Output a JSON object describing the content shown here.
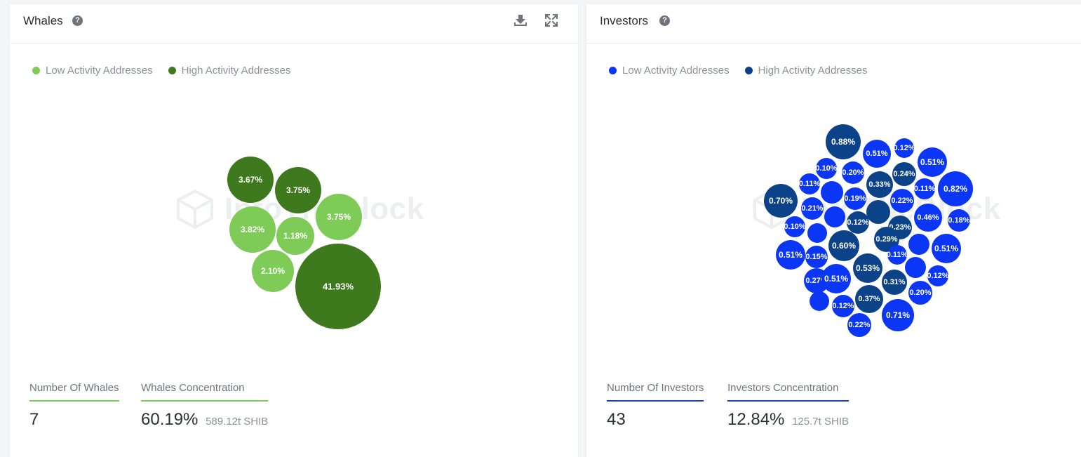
{
  "whales": {
    "title": "Whales",
    "help_icon": "question-circle-icon",
    "download_icon": "download-icon",
    "expand_icon": "expand-icon",
    "legend": [
      {
        "label": "Low Activity Addresses",
        "color": "#7fcb57"
      },
      {
        "label": "High Activity Addresses",
        "color": "#3e7a1d"
      }
    ],
    "watermark": "IntoTheBlock",
    "stats": {
      "count_label": "Number Of Whales",
      "count_value": "7",
      "concentration_label": "Whales Concentration",
      "concentration_value": "60.19%",
      "concentration_sub": "589.12t SHIB",
      "accent": "#7fcb57"
    }
  },
  "investors": {
    "title": "Investors",
    "help_icon": "question-circle-icon",
    "legend": [
      {
        "label": "Low Activity Addresses",
        "color": "#0b36f5"
      },
      {
        "label": "High Activity Addresses",
        "color": "#0c4287"
      }
    ],
    "watermark": "IntoTheBlock",
    "stats": {
      "count_label": "Number Of Investors",
      "count_value": "43",
      "concentration_label": "Investors Concentration",
      "concentration_value": "12.84%",
      "concentration_sub": "125.7t SHIB",
      "accent": "#1f3fb0"
    }
  },
  "chart_data": [
    {
      "type": "bubble",
      "title": "Whales",
      "unit": "% of supply",
      "series": [
        {
          "name": "Low Activity Addresses",
          "color": "#7fcb57"
        },
        {
          "name": "High Activity Addresses",
          "color": "#3e7a1d"
        }
      ],
      "points": [
        {
          "value": 3.67,
          "label": "3.67%",
          "series": "High Activity Addresses"
        },
        {
          "value": 3.75,
          "label": "3.75%",
          "series": "High Activity Addresses"
        },
        {
          "value": 3.82,
          "label": "3.82%",
          "series": "Low Activity Addresses"
        },
        {
          "value": 1.18,
          "label": "1.18%",
          "series": "Low Activity Addresses"
        },
        {
          "value": 3.75,
          "label": "3.75%",
          "series": "Low Activity Addresses"
        },
        {
          "value": 2.1,
          "label": "2.10%",
          "series": "Low Activity Addresses"
        },
        {
          "value": 41.93,
          "label": "41.93%",
          "series": "High Activity Addresses"
        }
      ]
    },
    {
      "type": "bubble",
      "title": "Investors",
      "unit": "% of supply",
      "series": [
        {
          "name": "Low Activity Addresses",
          "color": "#0b36f5"
        },
        {
          "name": "High Activity Addresses",
          "color": "#0c4287"
        }
      ],
      "points": [
        {
          "value": 0.88,
          "label": "0.88%",
          "series": "High Activity Addresses"
        },
        {
          "value": 0.51,
          "label": "0.51%",
          "series": "Low Activity Addresses"
        },
        {
          "value": 0.12,
          "label": "0.12%",
          "series": "Low Activity Addresses"
        },
        {
          "value": 0.51,
          "label": "0.51%",
          "series": "Low Activity Addresses"
        },
        {
          "value": 0.1,
          "label": "0.10%",
          "series": "Low Activity Addresses"
        },
        {
          "value": 0.2,
          "label": "0.20%",
          "series": "Low Activity Addresses"
        },
        {
          "value": 0.24,
          "label": "0.24%",
          "series": "High Activity Addresses"
        },
        {
          "value": 0.11,
          "label": "0.11%",
          "series": "Low Activity Addresses"
        },
        {
          "value": 0.33,
          "label": "0.33%",
          "series": "High Activity Addresses"
        },
        {
          "value": 0.11,
          "label": "0.11%",
          "series": "Low Activity Addresses"
        },
        {
          "value": 0.82,
          "label": "0.82%",
          "series": "Low Activity Addresses"
        },
        {
          "value": 0.7,
          "label": "0.70%",
          "series": "High Activity Addresses"
        },
        {
          "value": 0.21,
          "label": "0.21%",
          "series": "Low Activity Addresses"
        },
        {
          "value": 0.19,
          "label": "0.19%",
          "series": "Low Activity Addresses"
        },
        {
          "value": 0.22,
          "label": "0.22%",
          "series": "Low Activity Addresses"
        },
        {
          "value": 0.46,
          "label": "0.46%",
          "series": "Low Activity Addresses"
        },
        {
          "value": 0.18,
          "label": "0.18%",
          "series": "Low Activity Addresses"
        },
        {
          "value": 0.1,
          "label": "0.10%",
          "series": "Low Activity Addresses"
        },
        {
          "value": 0.12,
          "label": "0.12%",
          "series": "High Activity Addresses"
        },
        {
          "value": 0.23,
          "label": "0.23%",
          "series": "High Activity Addresses"
        },
        {
          "value": 0.6,
          "label": "0.60%",
          "series": "High Activity Addresses"
        },
        {
          "value": 0.29,
          "label": "0.29%",
          "series": "High Activity Addresses"
        },
        {
          "value": 0.51,
          "label": "0.51%",
          "series": "Low Activity Addresses"
        },
        {
          "value": 0.15,
          "label": "0.15%",
          "series": "Low Activity Addresses"
        },
        {
          "value": 0.11,
          "label": "0.11%",
          "series": "Low Activity Addresses"
        },
        {
          "value": 0.51,
          "label": "0.51%",
          "series": "Low Activity Addresses"
        },
        {
          "value": 0.53,
          "label": "0.53%",
          "series": "High Activity Addresses"
        },
        {
          "value": 0.27,
          "label": "0.27%",
          "series": "Low Activity Addresses"
        },
        {
          "value": 0.51,
          "label": "0.51%",
          "series": "Low Activity Addresses"
        },
        {
          "value": 0.31,
          "label": "0.31%",
          "series": "High Activity Addresses"
        },
        {
          "value": 0.12,
          "label": "0.12%",
          "series": "Low Activity Addresses"
        },
        {
          "value": 0.2,
          "label": "0.20%",
          "series": "Low Activity Addresses"
        },
        {
          "value": 0.37,
          "label": "0.37%",
          "series": "High Activity Addresses"
        },
        {
          "value": 0.12,
          "label": "0.12%",
          "series": "Low Activity Addresses"
        },
        {
          "value": 0.71,
          "label": "0.71%",
          "series": "Low Activity Addresses"
        },
        {
          "value": 0.22,
          "label": "0.22%",
          "series": "Low Activity Addresses"
        },
        {
          "value": null,
          "label": "",
          "series": "Low Activity Addresses"
        },
        {
          "value": null,
          "label": "",
          "series": "Low Activity Addresses"
        },
        {
          "value": null,
          "label": "",
          "series": "High Activity Addresses"
        },
        {
          "value": null,
          "label": "",
          "series": "Low Activity Addresses"
        },
        {
          "value": null,
          "label": "",
          "series": "Low Activity Addresses"
        },
        {
          "value": null,
          "label": "",
          "series": "Low Activity Addresses"
        },
        {
          "value": null,
          "label": "",
          "series": "Low Activity Addresses"
        }
      ]
    }
  ]
}
